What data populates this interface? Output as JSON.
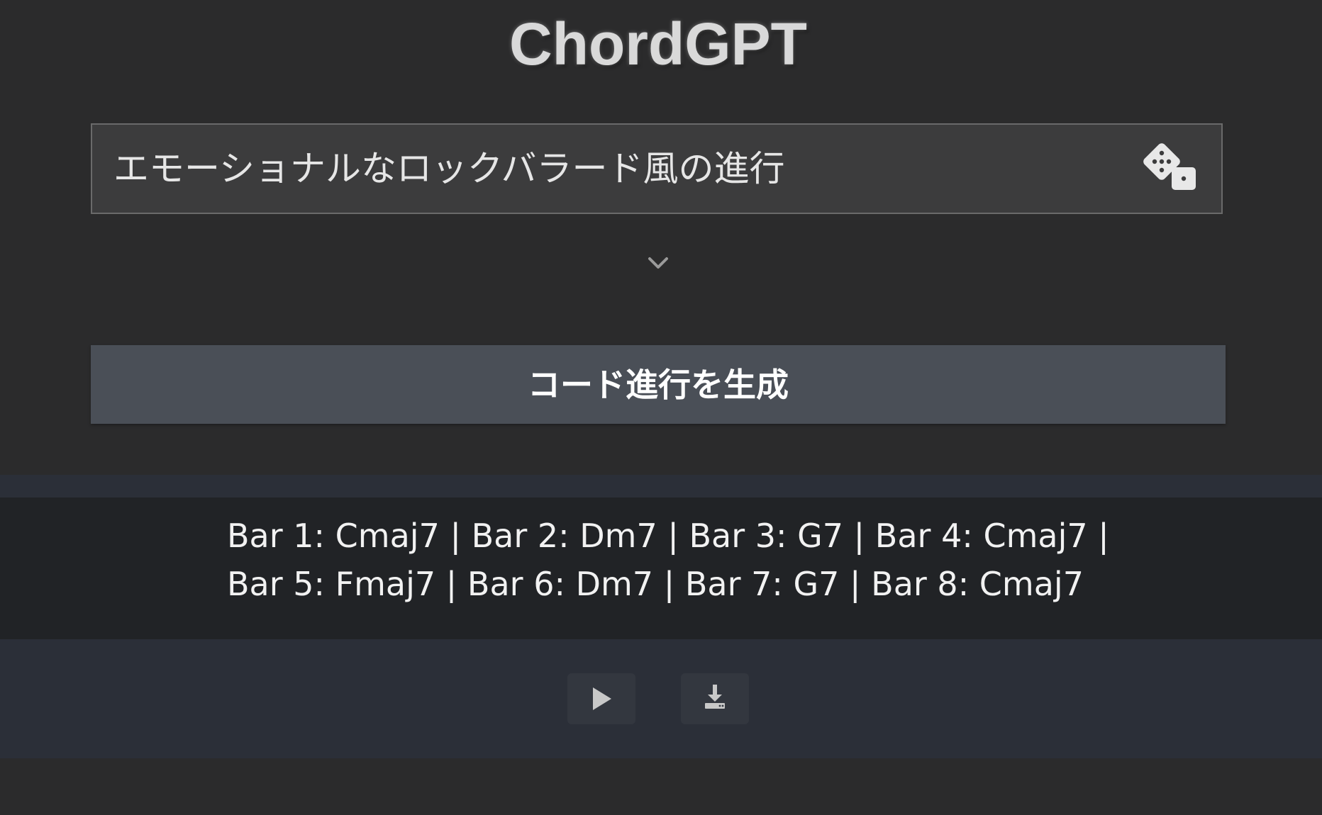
{
  "app": {
    "title": "ChordGPT"
  },
  "prompt": {
    "value": "エモーショナルなロックバラード風の進行",
    "random_icon": "dice-icon",
    "expand_icon": "chevron-down-icon"
  },
  "generate_button": {
    "label": "コード進行を生成"
  },
  "result": {
    "lines": [
      "Bar 1: Cmaj7 | Bar 2: Dm7 | Bar 3: G7 | Bar 4: Cmaj7 |",
      "Bar 5: Fmaj7 | Bar 6: Dm7 | Bar 7: G7 | Bar 8: Cmaj7"
    ]
  },
  "controls": {
    "play_icon": "play-icon",
    "download_icon": "download-icon"
  },
  "colors": {
    "background": "#2b2b2c",
    "input_background": "#3c3c3d",
    "button_background": "#4a4f57",
    "result_band": "#212326",
    "controls_band": "#2b2f38"
  }
}
